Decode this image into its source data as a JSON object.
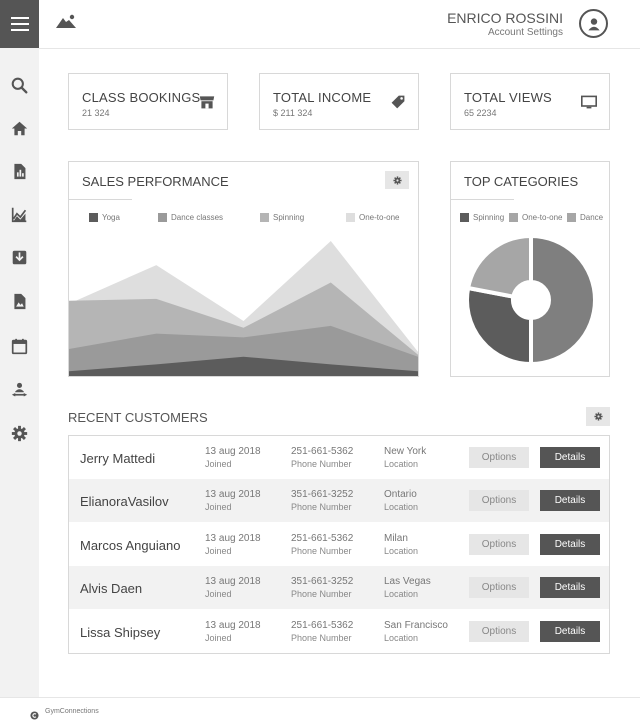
{
  "header": {
    "user_name": "ENRICO ROSSINI",
    "user_subtitle": "Account Settings"
  },
  "icons": {
    "menu": "hamburger-icon",
    "logo": "mountain-icon",
    "avatar": "user-icon",
    "sidebar": [
      "search-icon",
      "home-icon",
      "report-icon",
      "line-chart-icon",
      "inbox-icon",
      "image-file-icon",
      "calendar-icon",
      "people-icon",
      "gear-icon"
    ]
  },
  "stats": [
    {
      "title": "CLASS BOOKINGS",
      "value": "21 324",
      "icon": "store-icon"
    },
    {
      "title": "TOTAL INCOME",
      "value": "$ 211 324",
      "icon": "tag-icon"
    },
    {
      "title": "TOTAL VIEWS",
      "value": "65 2234",
      "icon": "monitor-icon"
    }
  ],
  "sales": {
    "title": "SALES PERFORMANCE",
    "legend": [
      "Yoga",
      "Dance classes",
      "Spinning",
      "One-to-one"
    ]
  },
  "categories": {
    "title": "TOP CATEGORIES",
    "legend": [
      "Spinning",
      "One-to-one",
      "Dance"
    ]
  },
  "chart_data": [
    {
      "type": "area",
      "x": [
        0,
        1,
        2,
        3,
        4
      ],
      "ylim": [
        0,
        140
      ],
      "series": [
        {
          "name": "Yoga",
          "values": [
            5,
            12,
            20,
            12,
            5
          ],
          "color": "#5c5c5c"
        },
        {
          "name": "Dance classes",
          "values": [
            28,
            44,
            40,
            52,
            20
          ],
          "color": "#9a9a9a"
        },
        {
          "name": "Spinning",
          "values": [
            78,
            80,
            50,
            97,
            22
          ],
          "color": "#b5b5b5"
        },
        {
          "name": "One-to-one",
          "values": [
            75,
            115,
            57,
            140,
            25
          ],
          "color": "#dedede"
        }
      ]
    },
    {
      "type": "pie",
      "series": [
        {
          "name": "Spinning",
          "value": 28,
          "color": "#5c5c5c"
        },
        {
          "name": "One-to-one",
          "value": 22,
          "color": "#a6a6a6"
        },
        {
          "name": "Dance",
          "value": 50,
          "color": "#7f7f7f"
        }
      ]
    }
  ],
  "customers": {
    "title": "RECENT CUSTOMERS",
    "options_label": "Options",
    "details_label": "Details",
    "joined_label": "Joined",
    "phone_label": "Phone Number",
    "location_label": "Location",
    "rows": [
      {
        "name": "Jerry Mattedi",
        "date": "13 aug 2018",
        "phone": "251-661-5362",
        "location": "New York"
      },
      {
        "name": "ElianoraVasilov",
        "date": "13 aug 2018",
        "phone": "351-661-3252",
        "location": "Ontario"
      },
      {
        "name": "Marcos Anguiano",
        "date": "13 aug 2018",
        "phone": "251-661-5362",
        "location": "Milan"
      },
      {
        "name": "Alvis Daen",
        "date": "13 aug 2018",
        "phone": "351-661-3252",
        "location": "Las Vegas"
      },
      {
        "name": "Lissa Shipsey",
        "date": "13 aug 2018",
        "phone": "251-661-5362",
        "location": "San Francisco"
      }
    ]
  },
  "footer": {
    "text": "GymConnections",
    "icon": "copyright-icon"
  }
}
